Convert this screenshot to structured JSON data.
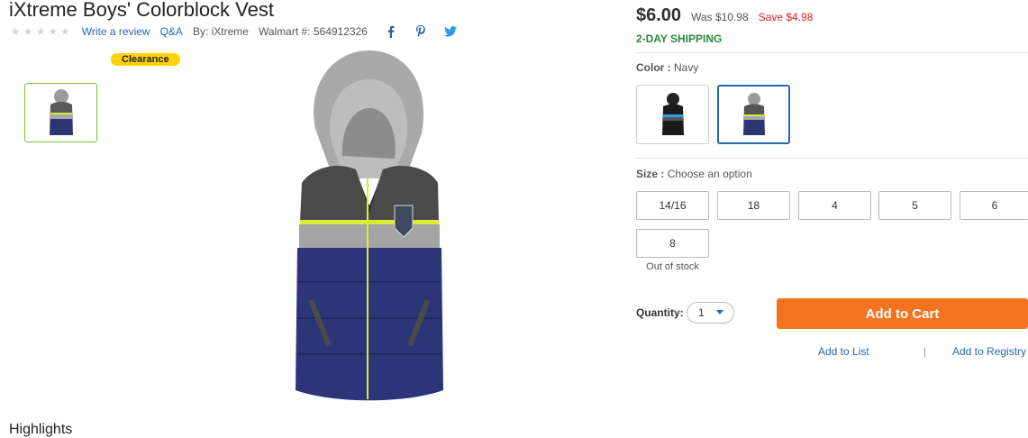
{
  "product": {
    "title": "iXtreme Boys' Colorblock Vest",
    "stars": "★★★★★",
    "write_review": "Write a review",
    "qa": "Q&A",
    "by": "By: iXtreme",
    "walmart_number": "Walmart #: 564912326",
    "share_icons": [
      "facebook-icon",
      "pinterest-icon",
      "twitter-icon"
    ],
    "clearance_badge": "Clearance",
    "highlights_heading": "Highlights"
  },
  "pricing": {
    "price": "$6.00",
    "was": "Was $10.98",
    "save": "Save $4.98",
    "shipping": "2-DAY SHIPPING"
  },
  "color": {
    "label": "Color :",
    "selected": "Navy",
    "options": [
      "black-vest-swatch",
      "navy-vest-swatch"
    ]
  },
  "size": {
    "label": "Size :",
    "placeholder": "Choose an option",
    "options": [
      "14/16",
      "18",
      "4",
      "5",
      "6",
      "8"
    ],
    "out_of_stock": "Out of stock"
  },
  "quantity": {
    "label": "Quantity:",
    "value": "1"
  },
  "actions": {
    "add_to_cart": "Add to Cart",
    "add_to_list": "Add to List",
    "divider": "|",
    "add_to_registry": "Add to Registry"
  },
  "colors": {
    "link": "#2668b5",
    "cart_button": "#f47321",
    "shipping": "#2d8a3d",
    "save": "#de1c24",
    "clearance": "#ffd400"
  }
}
